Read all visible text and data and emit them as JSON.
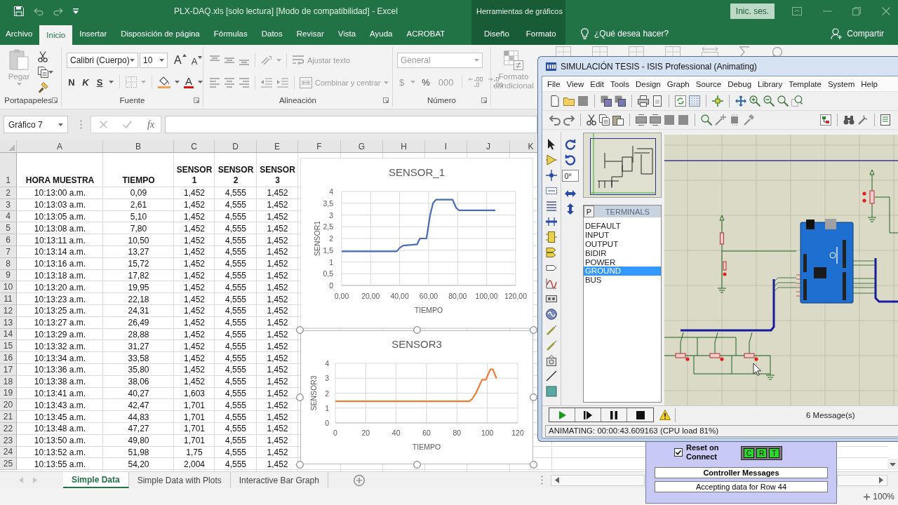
{
  "title_bar": {
    "title": "PLX-DAQ.xls [solo lectura] [Modo de compatibilidad] - Excel",
    "context_label": "Herramientas de gráficos",
    "sign_in_button": "Inic. ses."
  },
  "ribbon_tabs": [
    {
      "label": "Archivo",
      "kind": "main",
      "selected": false
    },
    {
      "label": "Inicio",
      "kind": "main",
      "selected": true
    },
    {
      "label": "Insertar",
      "kind": "main",
      "selected": false
    },
    {
      "label": "Disposición de página",
      "kind": "main",
      "selected": false
    },
    {
      "label": "Fórmulas",
      "kind": "main",
      "selected": false
    },
    {
      "label": "Datos",
      "kind": "main",
      "selected": false
    },
    {
      "label": "Revisar",
      "kind": "main",
      "selected": false
    },
    {
      "label": "Vista",
      "kind": "main",
      "selected": false
    },
    {
      "label": "Ayuda",
      "kind": "main",
      "selected": false
    },
    {
      "label": "ACROBAT",
      "kind": "main",
      "selected": false
    },
    {
      "label": "Diseño",
      "kind": "context",
      "selected": false
    },
    {
      "label": "Formato",
      "kind": "context",
      "selected": false
    }
  ],
  "tell_me": "¿Qué desea hacer?",
  "share_button": "Compartir",
  "ribbon": {
    "paste_button": {
      "label": "Pegar",
      "disabled": true
    },
    "clipboard_label": "Portapapeles",
    "font_name": "Calibri (Cuerpo)",
    "font_size": "10",
    "grow_font_button": "A",
    "shrink_font_button": "A",
    "bold_button": "N",
    "italic_button": "K",
    "underline_button": "S",
    "font_color_button": "A",
    "font_label": "Fuente",
    "wrap_text_button": {
      "label": "Ajustar texto",
      "disabled": true
    },
    "merge_button": {
      "label": "Combinar y centrar",
      "disabled": true
    },
    "alignment_label": "Alineación",
    "number_format": {
      "value": "General",
      "disabled": true
    },
    "number_buttons": [
      {
        "label": "$",
        "disabled": true
      },
      {
        "label": "%",
        "disabled": false
      },
      {
        "label": "000",
        "disabled": true
      }
    ],
    "number_label": "Número",
    "conditional_format_button": {
      "label": "Formato condicional",
      "disabled": true
    }
  },
  "formula_bar": {
    "name_box": "Gráfico 7",
    "function_button": "fx"
  },
  "sheet": {
    "columns": [
      "A",
      "B",
      "C",
      "D",
      "E",
      "F",
      "G",
      "H",
      "I",
      "J",
      "K"
    ],
    "header_row": {
      "number": "1",
      "cells": [
        "HORA MUESTRA",
        "TIEMPO",
        "SENSOR 1",
        "SENSOR 2",
        "SENSOR 3"
      ]
    },
    "rows": [
      {
        "number": "2",
        "cells": [
          "10:13:00 a.m.",
          "0,09",
          "1,452",
          "4,555",
          "1,452"
        ]
      },
      {
        "number": "3",
        "cells": [
          "10:13:03 a.m.",
          "2,61",
          "1,452",
          "4,555",
          "1,452"
        ]
      },
      {
        "number": "4",
        "cells": [
          "10:13:05 a.m.",
          "5,10",
          "1,452",
          "4,555",
          "1,452"
        ]
      },
      {
        "number": "5",
        "cells": [
          "10:13:08 a.m.",
          "7,80",
          "1,452",
          "4,555",
          "1,452"
        ]
      },
      {
        "number": "6",
        "cells": [
          "10:13:11 a.m.",
          "10,50",
          "1,452",
          "4,555",
          "1,452"
        ]
      },
      {
        "number": "7",
        "cells": [
          "10:13:14 a.m.",
          "13,27",
          "1,452",
          "4,555",
          "1,452"
        ]
      },
      {
        "number": "8",
        "cells": [
          "10:13:16 a.m.",
          "15,72",
          "1,452",
          "4,555",
          "1,452"
        ]
      },
      {
        "number": "9",
        "cells": [
          "10:13:18 a.m.",
          "17,82",
          "1,452",
          "4,555",
          "1,452"
        ]
      },
      {
        "number": "10",
        "cells": [
          "10:13:20 a.m.",
          "19,95",
          "1,452",
          "4,555",
          "1,452"
        ]
      },
      {
        "number": "11",
        "cells": [
          "10:13:23 a.m.",
          "22,18",
          "1,452",
          "4,555",
          "1,452"
        ]
      },
      {
        "number": "12",
        "cells": [
          "10:13:25 a.m.",
          "24,31",
          "1,452",
          "4,555",
          "1,452"
        ]
      },
      {
        "number": "13",
        "cells": [
          "10:13:27 a.m.",
          "26,49",
          "1,452",
          "4,555",
          "1,452"
        ]
      },
      {
        "number": "14",
        "cells": [
          "10:13:29 a.m.",
          "28,88",
          "1,452",
          "4,555",
          "1,452"
        ]
      },
      {
        "number": "15",
        "cells": [
          "10:13:32 a.m.",
          "31,27",
          "1,452",
          "4,555",
          "1,452"
        ]
      },
      {
        "number": "16",
        "cells": [
          "10:13:34 a.m.",
          "33,58",
          "1,452",
          "4,555",
          "1,452"
        ]
      },
      {
        "number": "17",
        "cells": [
          "10:13:36 a.m.",
          "35,80",
          "1,452",
          "4,555",
          "1,452"
        ]
      },
      {
        "number": "18",
        "cells": [
          "10:13:38 a.m.",
          "38,06",
          "1,452",
          "4,555",
          "1,452"
        ]
      },
      {
        "number": "19",
        "cells": [
          "10:13:41 a.m.",
          "40,27",
          "1,603",
          "4,555",
          "1,452"
        ]
      },
      {
        "number": "20",
        "cells": [
          "10:13:43 a.m.",
          "42,47",
          "1,701",
          "4,555",
          "1,452"
        ]
      },
      {
        "number": "21",
        "cells": [
          "10:13:45 a.m.",
          "44,83",
          "1,701",
          "4,555",
          "1,452"
        ]
      },
      {
        "number": "22",
        "cells": [
          "10:13:48 a.m.",
          "47,27",
          "1,701",
          "4,555",
          "1,452"
        ]
      },
      {
        "number": "23",
        "cells": [
          "10:13:50 a.m.",
          "49,80",
          "1,701",
          "4,555",
          "1,452"
        ]
      },
      {
        "number": "24",
        "cells": [
          "10:13:52 a.m.",
          "51,98",
          "1,75",
          "4,555",
          "1,452"
        ]
      },
      {
        "number": "25",
        "cells": [
          "10:13:55 a.m.",
          "54,20",
          "2,004",
          "4,555",
          "1,452"
        ]
      }
    ]
  },
  "charts": [
    {
      "selected": false,
      "chart_data": {
        "type": "line",
        "title": "SENSOR_1",
        "xlabel": "TIEMPO",
        "ylabel": "SENSOR1",
        "x": [
          0,
          38,
          40,
          42.5,
          52,
          54,
          58.5,
          61,
          63,
          65,
          76.5,
          79,
          81,
          106
        ],
        "series": [
          {
            "color": "#4a6cb5",
            "values": [
              1.45,
              1.45,
              1.6,
              1.7,
              1.75,
              2.0,
              2.0,
              3.0,
              3.5,
              3.65,
              3.65,
              3.3,
              3.2,
              3.2
            ]
          }
        ],
        "xlim": [
          0,
          120
        ],
        "ylim": [
          0,
          4
        ],
        "grid": true,
        "xticks": [
          {
            "value": 0,
            "label": "0,00"
          },
          {
            "value": 20,
            "label": "20,00"
          },
          {
            "value": 40,
            "label": "40,00"
          },
          {
            "value": 60,
            "label": "60,00"
          },
          {
            "value": 80,
            "label": "80,00"
          },
          {
            "value": 100,
            "label": "100,00"
          },
          {
            "value": 120,
            "label": "120,00"
          }
        ],
        "yticks": [
          {
            "value": 0,
            "label": "0"
          },
          {
            "value": 0.5,
            "label": "0,5"
          },
          {
            "value": 1,
            "label": "1"
          },
          {
            "value": 1.5,
            "label": "1,5"
          },
          {
            "value": 2,
            "label": "2"
          },
          {
            "value": 2.5,
            "label": "2,5"
          },
          {
            "value": 3,
            "label": "3"
          },
          {
            "value": 3.5,
            "label": "3,5"
          },
          {
            "value": 4,
            "label": "4"
          }
        ]
      }
    },
    {
      "selected": true,
      "chart_data": {
        "type": "line",
        "title": "SENSOR3",
        "xlabel": "TIEMPO",
        "ylabel": "SENSOR3",
        "x": [
          0,
          88,
          90,
          92.5,
          96.5,
          99,
          102,
          103.5,
          106
        ],
        "series": [
          {
            "color": "#ed7d31",
            "values": [
              1.45,
              1.45,
              1.6,
              2.0,
              2.9,
              2.9,
              3.6,
              3.6,
              3.0
            ]
          }
        ],
        "xlim": [
          0,
          120
        ],
        "ylim": [
          0,
          4
        ],
        "grid": true,
        "xticks": [
          0,
          20,
          40,
          60,
          80,
          100,
          120
        ],
        "yticks": [
          0,
          1,
          2,
          3,
          4
        ]
      }
    }
  ],
  "sheet_tabs": [
    {
      "label": "Simple Data",
      "selected": true
    },
    {
      "label": "Simple Data with Plots",
      "selected": false
    },
    {
      "label": "Interactive Bar Graph",
      "selected": false
    }
  ],
  "status_bar": {
    "zoom": "100%"
  },
  "isis_window": {
    "title": "SIMULACIÓN TESIS - ISIS Professional (Animating)",
    "menu": [
      "File",
      "View",
      "Edit",
      "Tools",
      "Design",
      "Graph",
      "Source",
      "Debug",
      "Library",
      "Template",
      "System",
      "Help"
    ],
    "rotation_field": "0°",
    "terminals_panel": {
      "mode_button": "P",
      "heading": "TERMINALS",
      "items": [
        {
          "label": "DEFAULT",
          "selected": false
        },
        {
          "label": "INPUT",
          "selected": false
        },
        {
          "label": "OUTPUT",
          "selected": false
        },
        {
          "label": "BIDIR",
          "selected": false
        },
        {
          "label": "POWER",
          "selected": false
        },
        {
          "label": "GROUND",
          "selected": true
        },
        {
          "label": "BUS",
          "selected": false
        }
      ]
    },
    "messages": "6 Message(s)",
    "status": "ANIMATING: 00:00:43.609163 (CPU load 81%)"
  },
  "plx_daq_panel": {
    "reset_checkbox": {
      "label": "Reset on Connect",
      "checked": true
    },
    "indicators": [
      {
        "label": "C",
        "on": true
      },
      {
        "label": "R",
        "on": true
      },
      {
        "label": "T",
        "on": true
      }
    ],
    "messages_heading": "Controller Messages",
    "message": "Accepting data for Row 44"
  }
}
